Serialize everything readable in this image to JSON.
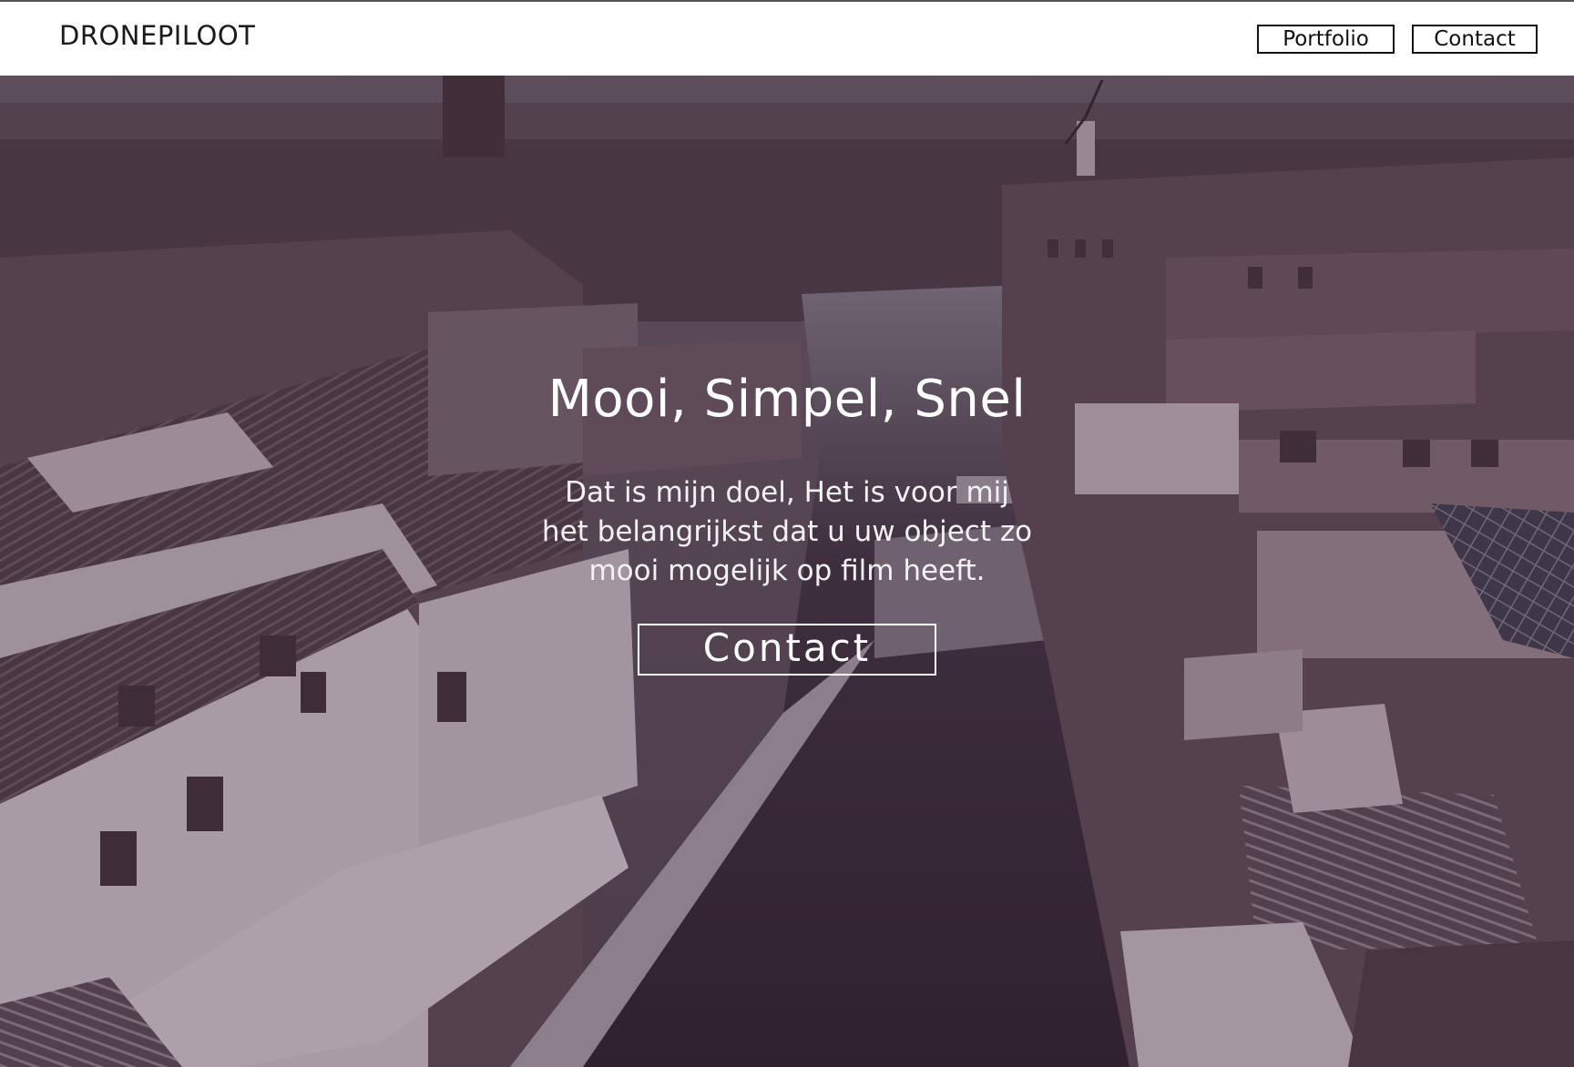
{
  "header": {
    "brand": "DRONEPILOOT",
    "nav": {
      "portfolio_label": "Portfolio",
      "contact_label": "Contact"
    }
  },
  "hero": {
    "title": "Mooi, Simpel, Snel",
    "text": "Dat is mijn doel, Het is voor mij het belangrijkst dat u uw object zo mooi mogelijk op film heeft.",
    "cta_label": "Contact",
    "background_image": "aerial-town-canal-winter-photo"
  },
  "colors": {
    "header_bg": "#ffffff",
    "header_text": "#111111",
    "hero_text": "#ffffff",
    "hero_overlay": "#46283c"
  }
}
